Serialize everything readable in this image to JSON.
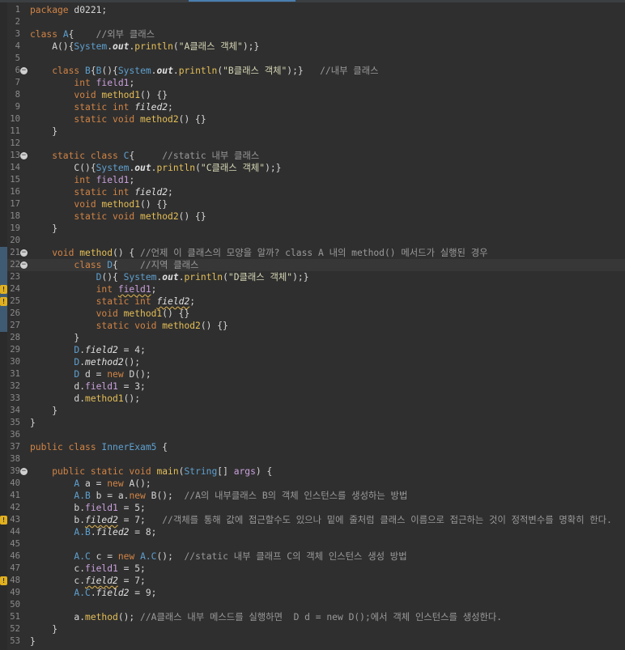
{
  "editor": {
    "language": "java",
    "lines": [
      {
        "n": "1",
        "tokens": [
          {
            "t": "package",
            "c": "k"
          },
          {
            "t": " d0221;",
            "c": "n"
          }
        ]
      },
      {
        "n": "2",
        "tokens": []
      },
      {
        "n": "3",
        "tokens": [
          {
            "t": "class ",
            "c": "k"
          },
          {
            "t": "A",
            "c": "t"
          },
          {
            "t": "{    ",
            "c": "n"
          },
          {
            "t": "//외부 클래스",
            "c": "c"
          }
        ]
      },
      {
        "n": "4",
        "tokens": [
          {
            "t": "    A(){",
            "c": "n"
          },
          {
            "t": "System",
            "c": "t"
          },
          {
            "t": ".",
            "c": "n"
          },
          {
            "t": "out",
            "c": "st"
          },
          {
            "t": ".",
            "c": "n"
          },
          {
            "t": "println",
            "c": "m"
          },
          {
            "t": "(",
            "c": "n"
          },
          {
            "t": "\"A클래스 객체\"",
            "c": "s"
          },
          {
            "t": ");}",
            "c": "n"
          }
        ]
      },
      {
        "n": "5",
        "tokens": []
      },
      {
        "n": "6",
        "fold": true,
        "tokens": [
          {
            "t": "    class ",
            "c": "k"
          },
          {
            "t": "B",
            "c": "t"
          },
          {
            "t": "{",
            "c": "n"
          },
          {
            "t": "B",
            "c": "t"
          },
          {
            "t": "(){",
            "c": "n"
          },
          {
            "t": "System",
            "c": "t"
          },
          {
            "t": ".",
            "c": "n"
          },
          {
            "t": "out",
            "c": "st"
          },
          {
            "t": ".",
            "c": "n"
          },
          {
            "t": "println",
            "c": "m"
          },
          {
            "t": "(",
            "c": "n"
          },
          {
            "t": "\"B클래스 객체\"",
            "c": "s"
          },
          {
            "t": ");}   ",
            "c": "n"
          },
          {
            "t": "//내부 클래스",
            "c": "c"
          }
        ]
      },
      {
        "n": "7",
        "tokens": [
          {
            "t": "        int ",
            "c": "k"
          },
          {
            "t": "field1",
            "c": "f"
          },
          {
            "t": ";",
            "c": "n"
          }
        ]
      },
      {
        "n": "8",
        "tokens": [
          {
            "t": "        void ",
            "c": "k"
          },
          {
            "t": "method1",
            "c": "m"
          },
          {
            "t": "() {}",
            "c": "n"
          }
        ]
      },
      {
        "n": "9",
        "tokens": [
          {
            "t": "        static int ",
            "c": "k"
          },
          {
            "t": "filed2",
            "c": "sf"
          },
          {
            "t": ";",
            "c": "n"
          }
        ]
      },
      {
        "n": "10",
        "tokens": [
          {
            "t": "        static void ",
            "c": "k"
          },
          {
            "t": "method2",
            "c": "m"
          },
          {
            "t": "() {}",
            "c": "n"
          }
        ]
      },
      {
        "n": "11",
        "tokens": [
          {
            "t": "    }",
            "c": "n"
          }
        ]
      },
      {
        "n": "12",
        "tokens": []
      },
      {
        "n": "13",
        "fold": true,
        "tokens": [
          {
            "t": "    static class ",
            "c": "k"
          },
          {
            "t": "C",
            "c": "t"
          },
          {
            "t": "{     ",
            "c": "n"
          },
          {
            "t": "//static 내부 클래스",
            "c": "c"
          }
        ]
      },
      {
        "n": "14",
        "tokens": [
          {
            "t": "        C(){",
            "c": "n"
          },
          {
            "t": "System",
            "c": "t"
          },
          {
            "t": ".",
            "c": "n"
          },
          {
            "t": "out",
            "c": "st"
          },
          {
            "t": ".",
            "c": "n"
          },
          {
            "t": "println",
            "c": "m"
          },
          {
            "t": "(",
            "c": "n"
          },
          {
            "t": "\"C클래스 객체\"",
            "c": "s"
          },
          {
            "t": ");}",
            "c": "n"
          }
        ]
      },
      {
        "n": "15",
        "tokens": [
          {
            "t": "        int ",
            "c": "k"
          },
          {
            "t": "field1",
            "c": "f"
          },
          {
            "t": ";",
            "c": "n"
          }
        ]
      },
      {
        "n": "16",
        "tokens": [
          {
            "t": "        static int ",
            "c": "k"
          },
          {
            "t": "field2",
            "c": "sf"
          },
          {
            "t": ";",
            "c": "n"
          }
        ]
      },
      {
        "n": "17",
        "tokens": [
          {
            "t": "        void ",
            "c": "k"
          },
          {
            "t": "method1",
            "c": "m"
          },
          {
            "t": "() {}",
            "c": "n"
          }
        ]
      },
      {
        "n": "18",
        "tokens": [
          {
            "t": "        static void ",
            "c": "k"
          },
          {
            "t": "method2",
            "c": "m"
          },
          {
            "t": "() {}",
            "c": "n"
          }
        ]
      },
      {
        "n": "19",
        "tokens": [
          {
            "t": "    }",
            "c": "n"
          }
        ]
      },
      {
        "n": "20",
        "tokens": []
      },
      {
        "n": "21",
        "fold": true,
        "ovr": true,
        "tokens": [
          {
            "t": "    void ",
            "c": "k"
          },
          {
            "t": "method",
            "c": "m"
          },
          {
            "t": "() { ",
            "c": "n"
          },
          {
            "t": "//언제 이 클래스의 모양을 알까? class A 내의 method() 메서드가 실행된 경우",
            "c": "c"
          }
        ]
      },
      {
        "n": "22",
        "fold": true,
        "ovr": true,
        "cur": true,
        "tokens": [
          {
            "t": "        class ",
            "c": "k"
          },
          {
            "t": "D",
            "c": "t"
          },
          {
            "t": "{    ",
            "c": "n"
          },
          {
            "t": "//지역 클래스",
            "c": "c"
          }
        ]
      },
      {
        "n": "23",
        "ovr": true,
        "tokens": [
          {
            "t": "            ",
            "c": "n"
          },
          {
            "t": "D",
            "c": "t"
          },
          {
            "t": "(){ ",
            "c": "n"
          },
          {
            "t": "System",
            "c": "t"
          },
          {
            "t": ".",
            "c": "n"
          },
          {
            "t": "out",
            "c": "st"
          },
          {
            "t": ".",
            "c": "n"
          },
          {
            "t": "println",
            "c": "m"
          },
          {
            "t": "(",
            "c": "n"
          },
          {
            "t": "\"D클래스 객체\"",
            "c": "s"
          },
          {
            "t": ");}",
            "c": "n"
          }
        ]
      },
      {
        "n": "24",
        "ovr": true,
        "warn": true,
        "tokens": [
          {
            "t": "            int ",
            "c": "k"
          },
          {
            "t": "field1",
            "c": "f sq"
          },
          {
            "t": ";",
            "c": "n"
          }
        ]
      },
      {
        "n": "25",
        "ovr": true,
        "warn": true,
        "tokens": [
          {
            "t": "            static int ",
            "c": "k"
          },
          {
            "t": "field2",
            "c": "sf sq"
          },
          {
            "t": ";",
            "c": "n"
          }
        ]
      },
      {
        "n": "26",
        "ovr": true,
        "tokens": [
          {
            "t": "            void ",
            "c": "k"
          },
          {
            "t": "method1",
            "c": "m"
          },
          {
            "t": "() {}",
            "c": "n"
          }
        ]
      },
      {
        "n": "27",
        "ovr": true,
        "tokens": [
          {
            "t": "            static void ",
            "c": "k"
          },
          {
            "t": "method2",
            "c": "m"
          },
          {
            "t": "() {}",
            "c": "n"
          }
        ]
      },
      {
        "n": "28",
        "tokens": [
          {
            "t": "        }",
            "c": "n"
          }
        ]
      },
      {
        "n": "29",
        "tokens": [
          {
            "t": "        ",
            "c": "n"
          },
          {
            "t": "D",
            "c": "t"
          },
          {
            "t": ".",
            "c": "n"
          },
          {
            "t": "field2",
            "c": "sf"
          },
          {
            "t": " = 4;",
            "c": "n"
          }
        ]
      },
      {
        "n": "30",
        "tokens": [
          {
            "t": "        ",
            "c": "n"
          },
          {
            "t": "D",
            "c": "t"
          },
          {
            "t": ".",
            "c": "n"
          },
          {
            "t": "method2",
            "c": "sf"
          },
          {
            "t": "();",
            "c": "n"
          }
        ]
      },
      {
        "n": "31",
        "tokens": [
          {
            "t": "        ",
            "c": "n"
          },
          {
            "t": "D",
            "c": "t"
          },
          {
            "t": " d = ",
            "c": "n"
          },
          {
            "t": "new ",
            "c": "k"
          },
          {
            "t": "D();",
            "c": "n"
          }
        ]
      },
      {
        "n": "32",
        "tokens": [
          {
            "t": "        d.",
            "c": "n"
          },
          {
            "t": "field1",
            "c": "f"
          },
          {
            "t": " = 3;",
            "c": "n"
          }
        ]
      },
      {
        "n": "33",
        "tokens": [
          {
            "t": "        d.",
            "c": "n"
          },
          {
            "t": "method1",
            "c": "m"
          },
          {
            "t": "();",
            "c": "n"
          }
        ]
      },
      {
        "n": "34",
        "tokens": [
          {
            "t": "    }",
            "c": "n"
          }
        ]
      },
      {
        "n": "35",
        "tokens": [
          {
            "t": "}",
            "c": "n"
          }
        ]
      },
      {
        "n": "36",
        "tokens": []
      },
      {
        "n": "37",
        "tokens": [
          {
            "t": "public class ",
            "c": "k"
          },
          {
            "t": "InnerExam5",
            "c": "t"
          },
          {
            "t": " {",
            "c": "n"
          }
        ]
      },
      {
        "n": "38",
        "tokens": []
      },
      {
        "n": "39",
        "fold": true,
        "tokens": [
          {
            "t": "    public static void ",
            "c": "k"
          },
          {
            "t": "main",
            "c": "m"
          },
          {
            "t": "(",
            "c": "n"
          },
          {
            "t": "String",
            "c": "t"
          },
          {
            "t": "[] ",
            "c": "n"
          },
          {
            "t": "args",
            "c": "f"
          },
          {
            "t": ") {",
            "c": "n"
          }
        ]
      },
      {
        "n": "40",
        "tokens": [
          {
            "t": "        ",
            "c": "n"
          },
          {
            "t": "A",
            "c": "t"
          },
          {
            "t": " a = ",
            "c": "n"
          },
          {
            "t": "new ",
            "c": "k"
          },
          {
            "t": "A();",
            "c": "n"
          }
        ]
      },
      {
        "n": "41",
        "tokens": [
          {
            "t": "        ",
            "c": "n"
          },
          {
            "t": "A.B",
            "c": "t"
          },
          {
            "t": " b = a.",
            "c": "n"
          },
          {
            "t": "new ",
            "c": "k"
          },
          {
            "t": "B();  ",
            "c": "n"
          },
          {
            "t": "//A의 내부클래스 B의 객체 인스턴스를 생성하는 방법",
            "c": "c"
          }
        ]
      },
      {
        "n": "42",
        "tokens": [
          {
            "t": "        b.",
            "c": "n"
          },
          {
            "t": "field1",
            "c": "f"
          },
          {
            "t": " = 5;",
            "c": "n"
          }
        ]
      },
      {
        "n": "43",
        "warn": true,
        "tokens": [
          {
            "t": "        b.",
            "c": "n"
          },
          {
            "t": "filed2",
            "c": "sf sq"
          },
          {
            "t": " = 7;   ",
            "c": "n"
          },
          {
            "t": "//객체를 통해 값에 접근할수도 있으나 밑에 줄처럼 클래스 이름으로 접근하는 것이 정적변수를 명확히 한다.",
            "c": "c"
          }
        ]
      },
      {
        "n": "44",
        "tokens": [
          {
            "t": "        ",
            "c": "n"
          },
          {
            "t": "A.B",
            "c": "t"
          },
          {
            "t": ".",
            "c": "n"
          },
          {
            "t": "filed2",
            "c": "sf"
          },
          {
            "t": " = 8;",
            "c": "n"
          }
        ]
      },
      {
        "n": "45",
        "tokens": []
      },
      {
        "n": "46",
        "tokens": [
          {
            "t": "        ",
            "c": "n"
          },
          {
            "t": "A.C",
            "c": "t"
          },
          {
            "t": " c = ",
            "c": "n"
          },
          {
            "t": "new ",
            "c": "k"
          },
          {
            "t": "A.C",
            "c": "t"
          },
          {
            "t": "();  ",
            "c": "n"
          },
          {
            "t": "//static 내부 클래프 C의 객체 인스턴스 생성 방법",
            "c": "c"
          }
        ]
      },
      {
        "n": "47",
        "tokens": [
          {
            "t": "        c.",
            "c": "n"
          },
          {
            "t": "field1",
            "c": "f"
          },
          {
            "t": " = 5;",
            "c": "n"
          }
        ]
      },
      {
        "n": "48",
        "warn": true,
        "tokens": [
          {
            "t": "        c.",
            "c": "n"
          },
          {
            "t": "field2",
            "c": "sf sq"
          },
          {
            "t": " = 7;",
            "c": "n"
          }
        ]
      },
      {
        "n": "49",
        "tokens": [
          {
            "t": "        ",
            "c": "n"
          },
          {
            "t": "A.C",
            "c": "t"
          },
          {
            "t": ".",
            "c": "n"
          },
          {
            "t": "field2",
            "c": "sf"
          },
          {
            "t": " = 9;",
            "c": "n"
          }
        ]
      },
      {
        "n": "50",
        "tokens": []
      },
      {
        "n": "51",
        "tokens": [
          {
            "t": "        a.",
            "c": "n"
          },
          {
            "t": "method",
            "c": "m"
          },
          {
            "t": "(); ",
            "c": "n"
          },
          {
            "t": "//A클래스 내부 메스드를 실행하면  D d = new D();에서 객체 인스턴스를 생성한다.",
            "c": "c"
          }
        ]
      },
      {
        "n": "52",
        "tokens": [
          {
            "t": "    }",
            "c": "n"
          }
        ]
      },
      {
        "n": "53",
        "tokens": [
          {
            "t": "}",
            "c": "n"
          }
        ]
      }
    ]
  }
}
